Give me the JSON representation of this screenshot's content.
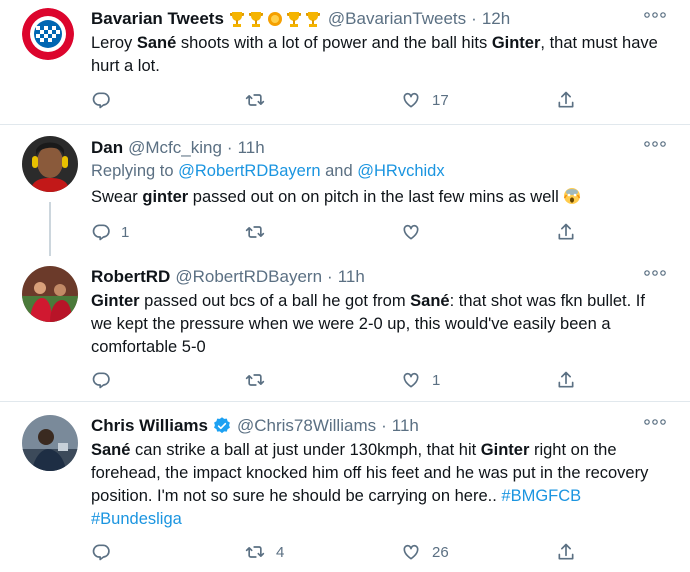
{
  "tweets": [
    {
      "name": "Bavarian Tweets",
      "handle": "@BavarianTweets",
      "time": "12h",
      "segments": [
        {
          "t": "Leroy "
        },
        {
          "t": "Sané",
          "b": true
        },
        {
          "t": " shoots with a lot of power and the ball hits "
        },
        {
          "t": "Ginter",
          "b": true
        },
        {
          "t": ", that must have hurt a lot."
        }
      ],
      "reply_count": "",
      "retweet_count": "",
      "like_count": "17"
    },
    {
      "name": "Dan",
      "handle": "@Mcfc_king",
      "time": "11h",
      "replying_prefix": "Replying to ",
      "replying_1": "@RobertRDBayern",
      "replying_and": " and ",
      "replying_2": "@HRvchidx",
      "segments": [
        {
          "t": "Swear "
        },
        {
          "t": "ginter",
          "b": true
        },
        {
          "t": " passed out on on pitch in the last few mins as well"
        }
      ],
      "reply_count": "1",
      "retweet_count": "",
      "like_count": ""
    },
    {
      "name": "RobertRD",
      "handle": "@RobertRDBayern",
      "time": "11h",
      "segments": [
        {
          "t": "Ginter",
          "b": true
        },
        {
          "t": " passed out bcs of a ball he got from "
        },
        {
          "t": "Sané",
          "b": true
        },
        {
          "t": ": that shot was fkn bullet. If we kept the pressure when we were 2-0 up, this would've easily been a comfortable 5-0"
        }
      ],
      "reply_count": "",
      "retweet_count": "",
      "like_count": "1"
    },
    {
      "name": "Chris Williams",
      "handle": "@Chris78Williams",
      "time": "11h",
      "segments": [
        {
          "t": "Sané",
          "b": true
        },
        {
          "t": " can strike a ball at just under 130kmph, that hit "
        },
        {
          "t": "Ginter",
          "b": true
        },
        {
          "t": " right on the forehead, the impact knocked him off his feet and he was put in the recovery position. I'm not so sure he should be carrying on here.. "
        },
        {
          "t": "#BMGFCB",
          "link": true
        },
        {
          "t": " "
        },
        {
          "t": "#Bundesliga",
          "link": true
        }
      ],
      "reply_count": "",
      "retweet_count": "4",
      "like_count": "26"
    }
  ],
  "colors": {
    "secondary_text": "#5b7083",
    "link": "#1b95e0",
    "verified": "#1da1f2",
    "divider": "#e1e8ed"
  },
  "icons": [
    "reply-icon",
    "retweet-icon",
    "like-icon",
    "share-icon",
    "more-icon",
    "trophy-icon",
    "verified-icon",
    "scream-emoji-icon"
  ]
}
